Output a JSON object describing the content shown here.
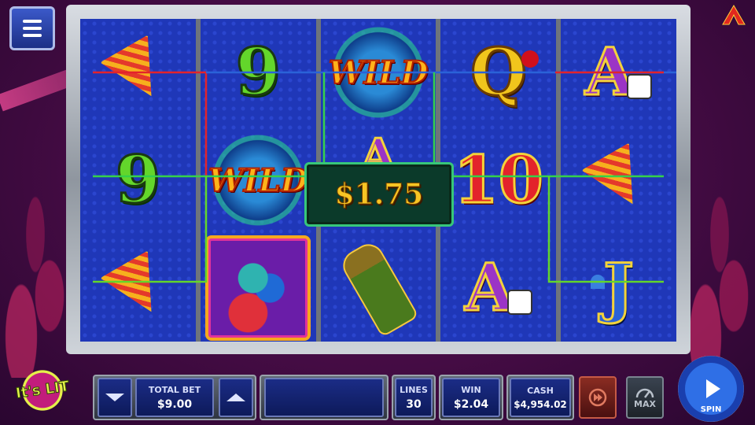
{
  "menu": {
    "icon": "hamburger-menu-icon"
  },
  "brand_logo": {
    "icon": "brand-logo-icon"
  },
  "game_logo": {
    "text": "It's LIT"
  },
  "reels": [
    [
      "party-popper",
      "9",
      "party-popper"
    ],
    [
      "9",
      "WILD",
      "fireworks-box"
    ],
    [
      "WILD",
      "A",
      "champagne-bottle"
    ],
    [
      "Q",
      "10",
      "A"
    ],
    [
      "A",
      "party-popper",
      "J"
    ]
  ],
  "win_display": {
    "amount": "$1.75"
  },
  "win_line_colors": [
    "#e3232b",
    "#2a62d8",
    "#35d14a",
    "#63d62b"
  ],
  "controls": {
    "total_bet": {
      "label": "TOTAL BET",
      "value": "$9.00"
    },
    "message": {
      "text": ""
    },
    "lines": {
      "label": "LINES",
      "value": "30"
    },
    "win": {
      "label": "WIN",
      "value": "$2.04"
    },
    "cash": {
      "label": "CASH",
      "value": "$4,954.02"
    },
    "max": {
      "label": "MAX"
    },
    "spin": {
      "label": "SPIN"
    }
  }
}
